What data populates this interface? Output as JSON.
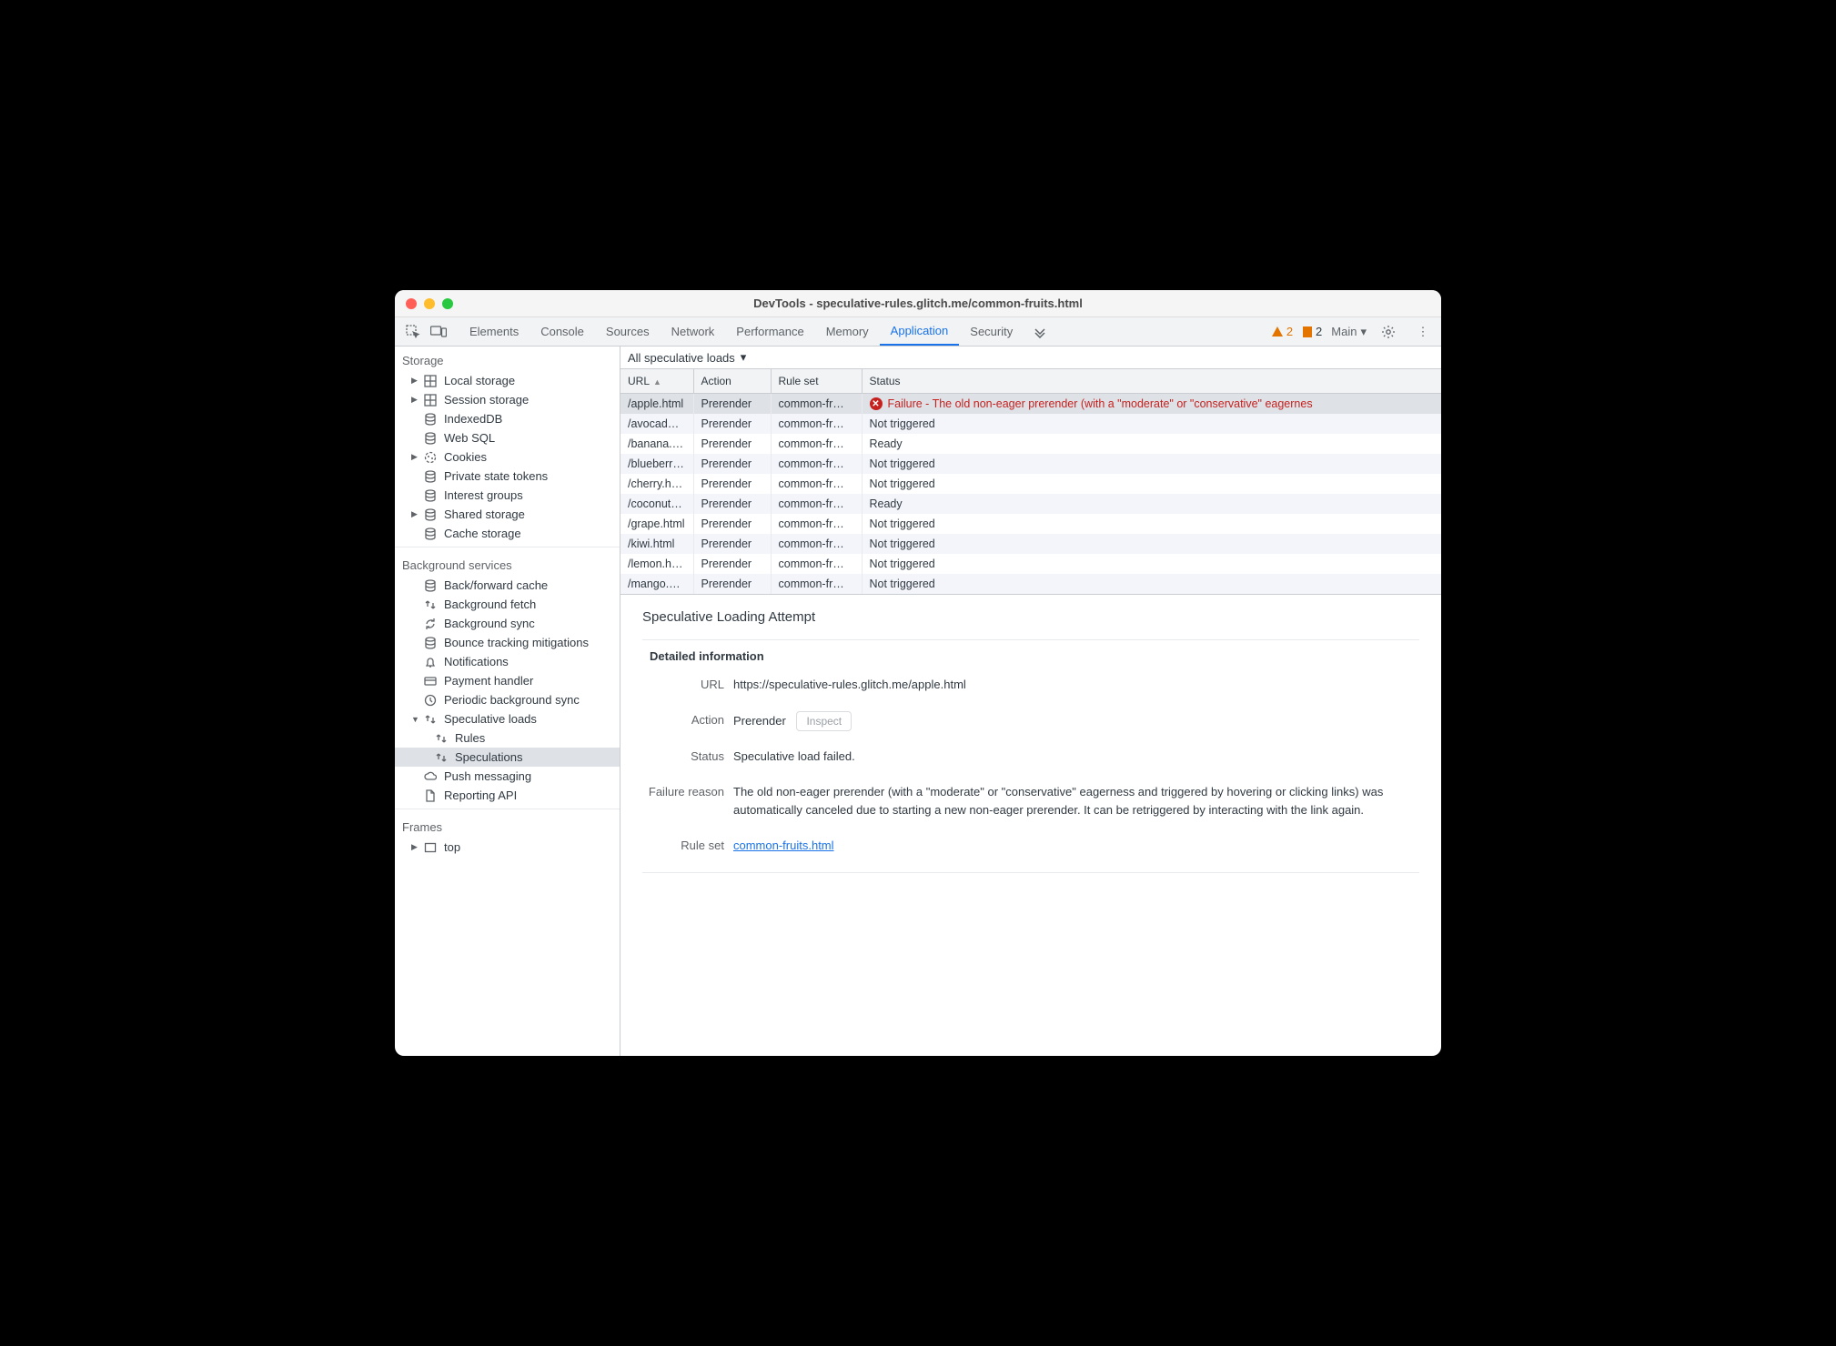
{
  "window": {
    "title": "DevTools - speculative-rules.glitch.me/common-fruits.html"
  },
  "toolbar": {
    "tabs": [
      "Elements",
      "Console",
      "Sources",
      "Network",
      "Performance",
      "Memory",
      "Application",
      "Security"
    ],
    "active_tab": "Application",
    "warn_count": "2",
    "info_count": "2",
    "main_label": "Main"
  },
  "sidebar": {
    "storage_header": "Storage",
    "storage_items": [
      {
        "label": "Local storage",
        "icon": "grid",
        "expand": true
      },
      {
        "label": "Session storage",
        "icon": "grid",
        "expand": true
      },
      {
        "label": "IndexedDB",
        "icon": "db",
        "expand": false
      },
      {
        "label": "Web SQL",
        "icon": "db",
        "expand": false
      },
      {
        "label": "Cookies",
        "icon": "cookie",
        "expand": true
      },
      {
        "label": "Private state tokens",
        "icon": "db",
        "expand": false
      },
      {
        "label": "Interest groups",
        "icon": "db",
        "expand": false
      },
      {
        "label": "Shared storage",
        "icon": "db",
        "expand": true
      },
      {
        "label": "Cache storage",
        "icon": "db",
        "expand": false
      }
    ],
    "bg_header": "Background services",
    "bg_items": [
      {
        "label": "Back/forward cache",
        "icon": "db"
      },
      {
        "label": "Background fetch",
        "icon": "updown"
      },
      {
        "label": "Background sync",
        "icon": "sync"
      },
      {
        "label": "Bounce tracking mitigations",
        "icon": "db"
      },
      {
        "label": "Notifications",
        "icon": "bell"
      },
      {
        "label": "Payment handler",
        "icon": "card"
      },
      {
        "label": "Periodic background sync",
        "icon": "clock"
      },
      {
        "label": "Speculative loads",
        "icon": "updown",
        "expand": "down",
        "children": [
          {
            "label": "Rules",
            "icon": "updown"
          },
          {
            "label": "Speculations",
            "icon": "updown",
            "selected": true
          }
        ]
      },
      {
        "label": "Push messaging",
        "icon": "cloud"
      },
      {
        "label": "Reporting API",
        "icon": "file"
      }
    ],
    "frames_header": "Frames",
    "frames_items": [
      {
        "label": "top",
        "icon": "frame",
        "expand": true
      }
    ]
  },
  "filter": {
    "label": "All speculative loads"
  },
  "table": {
    "headers": [
      "URL",
      "Action",
      "Rule set",
      "Status"
    ],
    "rows": [
      {
        "url": "/apple.html",
        "action": "Prerender",
        "ruleset": "common-fr…",
        "status": "Failure - The old non-eager prerender (with a \"moderate\" or \"conservative\" eagernes",
        "error": true,
        "selected": true
      },
      {
        "url": "/avocad…",
        "action": "Prerender",
        "ruleset": "common-fr…",
        "status": "Not triggered"
      },
      {
        "url": "/banana.…",
        "action": "Prerender",
        "ruleset": "common-fr…",
        "status": "Ready"
      },
      {
        "url": "/blueberr…",
        "action": "Prerender",
        "ruleset": "common-fr…",
        "status": "Not triggered"
      },
      {
        "url": "/cherry.h…",
        "action": "Prerender",
        "ruleset": "common-fr…",
        "status": "Not triggered"
      },
      {
        "url": "/coconut…",
        "action": "Prerender",
        "ruleset": "common-fr…",
        "status": "Ready"
      },
      {
        "url": "/grape.html",
        "action": "Prerender",
        "ruleset": "common-fr…",
        "status": "Not triggered"
      },
      {
        "url": "/kiwi.html",
        "action": "Prerender",
        "ruleset": "common-fr…",
        "status": "Not triggered"
      },
      {
        "url": "/lemon.h…",
        "action": "Prerender",
        "ruleset": "common-fr…",
        "status": "Not triggered"
      },
      {
        "url": "/mango.…",
        "action": "Prerender",
        "ruleset": "common-fr…",
        "status": "Not triggered"
      }
    ]
  },
  "detail": {
    "title": "Speculative Loading Attempt",
    "section_title": "Detailed information",
    "url_label": "URL",
    "url_value": "https://speculative-rules.glitch.me/apple.html",
    "action_label": "Action",
    "action_value": "Prerender",
    "inspect_label": "Inspect",
    "status_label": "Status",
    "status_value": "Speculative load failed.",
    "reason_label": "Failure reason",
    "reason_value": "The old non-eager prerender (with a \"moderate\" or \"conservative\" eagerness and triggered by hovering or clicking links) was automatically canceled due to starting a new non-eager prerender. It can be retriggered by interacting with the link again.",
    "ruleset_label": "Rule set",
    "ruleset_value": "common-fruits.html"
  }
}
